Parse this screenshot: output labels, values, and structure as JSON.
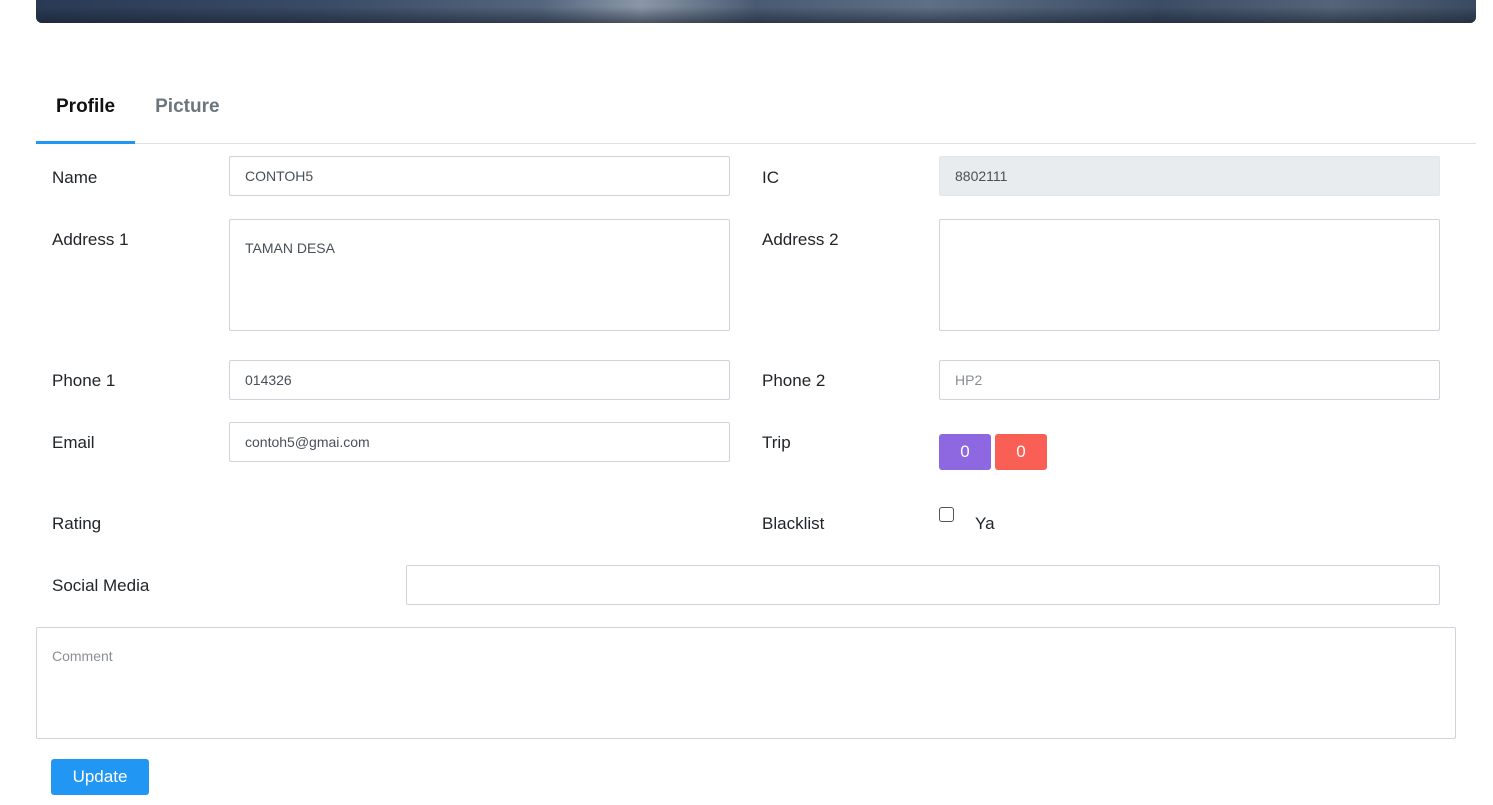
{
  "tabs": [
    {
      "label": "Profile",
      "active": true
    },
    {
      "label": "Picture",
      "active": false
    }
  ],
  "form": {
    "name": {
      "label": "Name",
      "value": "CONTOH5"
    },
    "ic": {
      "label": "IC",
      "value": "8802111"
    },
    "address1": {
      "label": "Address 1",
      "value": "TAMAN DESA"
    },
    "address2": {
      "label": "Address 2",
      "value": ""
    },
    "phone1": {
      "label": "Phone 1",
      "value": "014326"
    },
    "phone2": {
      "label": "Phone 2",
      "value": "",
      "placeholder": "HP2"
    },
    "email": {
      "label": "Email",
      "value": "contoh5@gmai.com"
    },
    "trip": {
      "label": "Trip",
      "count_purple": "0",
      "count_red": "0"
    },
    "rating": {
      "label": "Rating"
    },
    "blacklist": {
      "label": "Blacklist",
      "option_label": "Ya",
      "checked": false
    },
    "social_media": {
      "label": "Social Media",
      "value": ""
    },
    "comment": {
      "value": "",
      "placeholder": "Comment"
    }
  },
  "actions": {
    "update_label": "Update"
  },
  "colors": {
    "accent": "#2196f3",
    "badge_purple": "#8e68e0",
    "badge_red": "#fa5f55"
  }
}
